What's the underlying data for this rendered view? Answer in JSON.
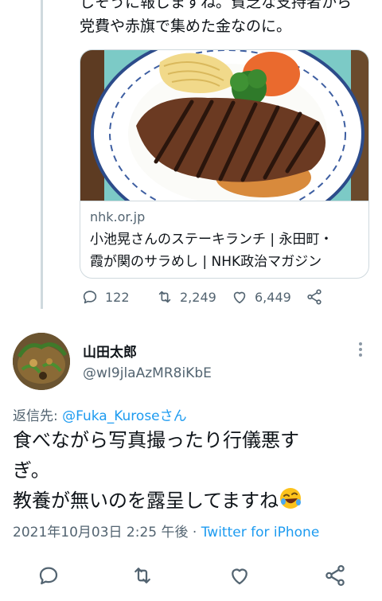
{
  "previous_tweet": {
    "text_tail": "しそうに報じますね。貧乏な支持者から\n党費や赤旗で集めた金なのに。",
    "link_card": {
      "image_icon": "steak-photo",
      "domain": "nhk.or.jp",
      "title": "小池晃さんのステーキランチ | 永田町・\n霞が関のサラめし | NHK政治マガジン"
    },
    "actions": {
      "reply_count": "122",
      "retweet_count": "2,249",
      "like_count": "6,449"
    }
  },
  "tweet": {
    "display_name": "山田太郎",
    "handle": "@wI9jlaAzMR8iKbE",
    "reply_prefix": "返信先: ",
    "reply_mention": "@Fuka_Kuroseさん",
    "text": "食べながら写真撮ったり行儀悪す\nぎ。\n教養が無いのを露呈してますね",
    "emoji_icon": "rofl-emoji",
    "timestamp": "2021年10月03日 2:25 午後 · ",
    "client": "Twitter for iPhone"
  },
  "colors": {
    "accent": "#1d9bf0",
    "secondary_text": "#536471",
    "border": "#cfd9de"
  }
}
